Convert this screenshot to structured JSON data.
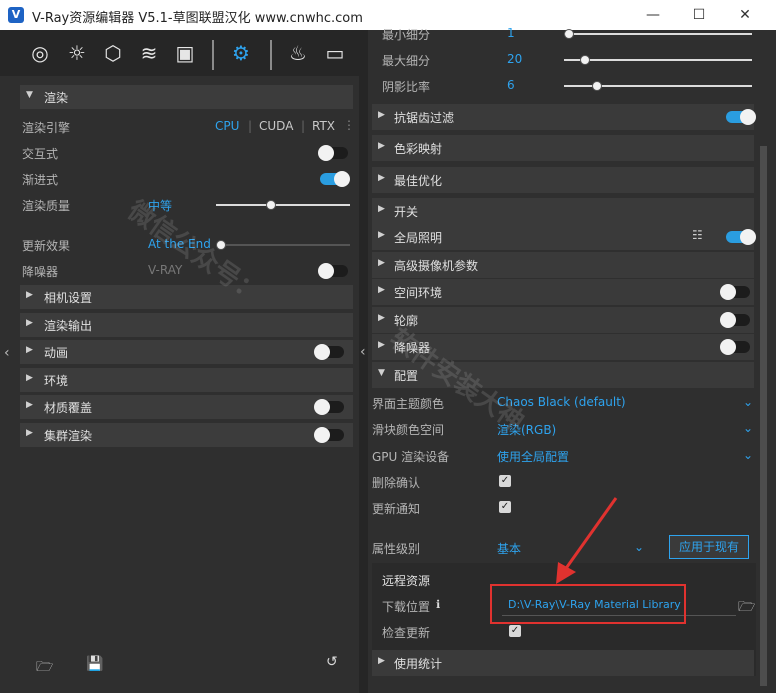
{
  "window": {
    "title": "V-Ray资源编辑器 V5.1-草图联盟汉化 www.cnwhc.com",
    "app_icon": "V",
    "minimize": "—",
    "maximize": "☐",
    "close": "✕"
  },
  "left": {
    "render_section": "渲染",
    "render_engine_label": "渲染引擎",
    "engines": [
      "CPU",
      "CUDA",
      "RTX"
    ],
    "interactive_label": "交互式",
    "progressive_label": "渐进式",
    "quality_label": "渲染质量",
    "quality_value": "中等",
    "update_effects_label": "更新效果",
    "update_effects_value": "At the End",
    "denoiser_label": "降噪器",
    "denoiser_value": "V-RAY",
    "sections": [
      "相机设置",
      "渲染输出",
      "动画",
      "环境",
      "材质覆盖",
      "集群渲染"
    ]
  },
  "right": {
    "min_subdiv_label": "最小细分",
    "min_subdiv_value": "1",
    "max_subdiv_label": "最大细分",
    "max_subdiv_value": "20",
    "shadow_ratio_label": "阴影比率",
    "shadow_ratio_value": "6",
    "sections": [
      "抗锯齿过滤",
      "色彩映射",
      "最佳优化",
      "开关",
      "全局照明",
      "高级摄像机参数",
      "空间环境",
      "轮廓",
      "降噪器"
    ],
    "config_section": "配置",
    "theme_label": "界面主题颜色",
    "theme_value": "Chaos Black (default)",
    "slider_color_label": "滑块颜色空间",
    "slider_color_value": "渲染(RGB)",
    "gpu_label": "GPU 渲染设备",
    "gpu_value": "使用全局配置",
    "delete_confirm_label": "删除确认",
    "update_notify_label": "更新通知",
    "prop_level_label": "属性级别",
    "prop_level_value": "基本",
    "apply_button": "应用于现有",
    "remote_label": "远程资源",
    "download_label": "下载位置",
    "download_path": "D:\\V-Ray\\V-Ray Material Library",
    "check_update_label": "检查更新",
    "usage_stats_section": "使用统计"
  },
  "watermarks": [
    "微信公众号：",
    "软件安装大神"
  ]
}
